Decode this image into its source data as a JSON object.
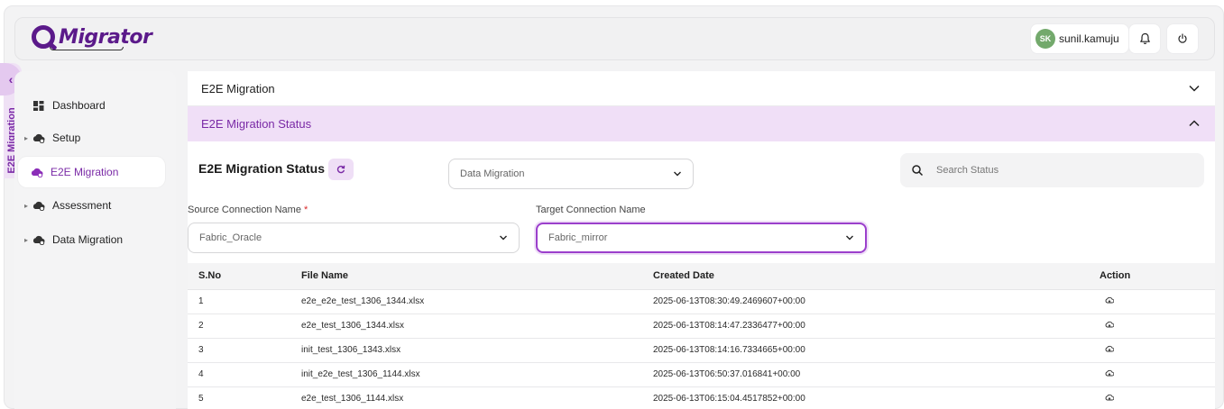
{
  "header": {
    "logo_text": "Migrator",
    "user_initials": "SK",
    "username": "sunil.kamuju"
  },
  "side_tab": {
    "label": "E2E Migration"
  },
  "sidebar": {
    "items": [
      {
        "label": "Dashboard",
        "icon": "dashboard-icon",
        "expandable": false
      },
      {
        "label": "Setup",
        "icon": "cloud-gear-icon",
        "expandable": true
      },
      {
        "label": "E2E Migration",
        "icon": "cloud-sync-icon",
        "expandable": false,
        "active": true
      },
      {
        "label": "Assessment",
        "icon": "cloud-gear-icon",
        "expandable": true
      },
      {
        "label": "Data Migration",
        "icon": "cloud-gear-icon",
        "expandable": true
      }
    ]
  },
  "accordion": {
    "section1_title": "E2E Migration",
    "section2_title": "E2E Migration Status"
  },
  "status_panel": {
    "title": "E2E Migration Status",
    "migration_type_value": "Data Migration",
    "search_placeholder": "Search Status",
    "source_label": "Source Connection Name",
    "source_required_mark": "*",
    "source_value": "Fabric_Oracle",
    "target_label": "Target Connection Name",
    "target_value": "Fabric_mirror"
  },
  "table": {
    "headers": [
      "S.No",
      "File Name",
      "Created Date",
      "Action"
    ],
    "rows": [
      {
        "sno": "1",
        "file": "e2e_e2e_test_1306_1344.xlsx",
        "created": "2025-06-13T08:30:49.2469607+00:00"
      },
      {
        "sno": "2",
        "file": "e2e_test_1306_1344.xlsx",
        "created": "2025-06-13T08:14:47.2336477+00:00"
      },
      {
        "sno": "3",
        "file": "init_test_1306_1343.xlsx",
        "created": "2025-06-13T08:14:16.7334665+00:00"
      },
      {
        "sno": "4",
        "file": "init_e2e_test_1306_1144.xlsx",
        "created": "2025-06-13T06:50:37.016841+00:00"
      },
      {
        "sno": "5",
        "file": "e2e_test_1306_1144.xlsx",
        "created": "2025-06-13T06:15:04.4517852+00:00"
      }
    ]
  },
  "colors": {
    "accent": "#7a2aa6",
    "accent_light": "#f0dff7",
    "avatar_bg": "#73a96c",
    "required": "#d9292a"
  }
}
